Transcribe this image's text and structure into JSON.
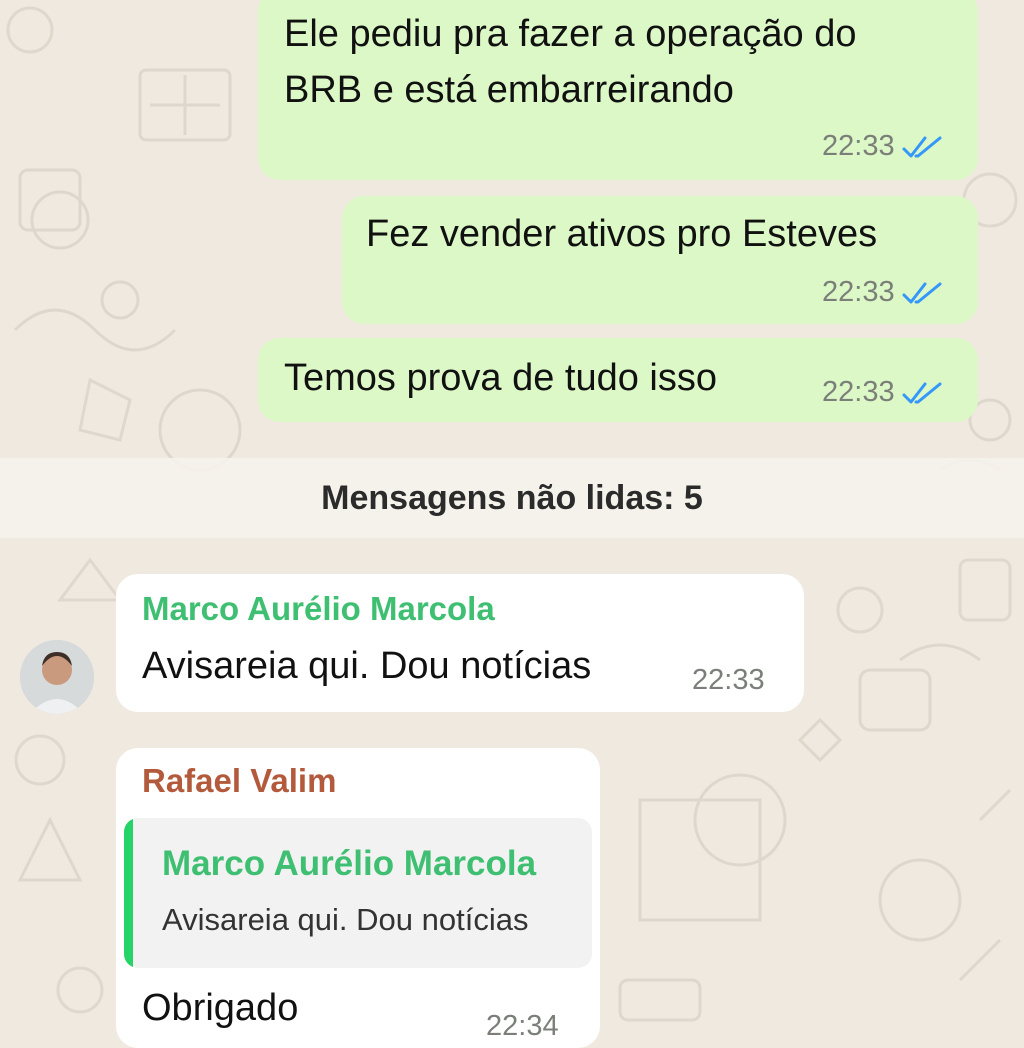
{
  "unread_divider": {
    "label": "Mensagens não lidas: 5"
  },
  "messages": [
    {
      "direction": "outgoing",
      "lines": [
        "Ele pediu pra fazer a operação do",
        "BRB e está embarreirando"
      ],
      "time": "22:33",
      "status": "read"
    },
    {
      "direction": "outgoing",
      "lines": [
        "Fez vender ativos pro Esteves"
      ],
      "time": "22:33",
      "status": "read"
    },
    {
      "direction": "outgoing",
      "lines": [
        "Temos prova de tudo isso"
      ],
      "time": "22:33",
      "status": "read"
    },
    {
      "direction": "incoming",
      "sender": "Marco Aurélio Marcola",
      "lines": [
        "Avisareia qui. Dou notícias"
      ],
      "time": "22:33"
    },
    {
      "direction": "incoming",
      "sender": "Rafael Valim",
      "reply_to": {
        "sender": "Marco Aurélio Marcola",
        "text": "Avisareia qui. Dou notícias"
      },
      "lines": [
        "Obrigado"
      ],
      "time": "22:34"
    }
  ],
  "colors": {
    "outgoing_bubble": "#dcf8c6",
    "incoming_bubble": "#ffffff",
    "read_ticks": "#3497f9",
    "sender_marco": "#3fbf72",
    "sender_rafael": "#b45a3c",
    "quote_bar": "#25d366",
    "wallpaper": "#efe9e0"
  },
  "icons": {
    "read_receipt": "double-check-icon",
    "avatar": "user-avatar"
  }
}
